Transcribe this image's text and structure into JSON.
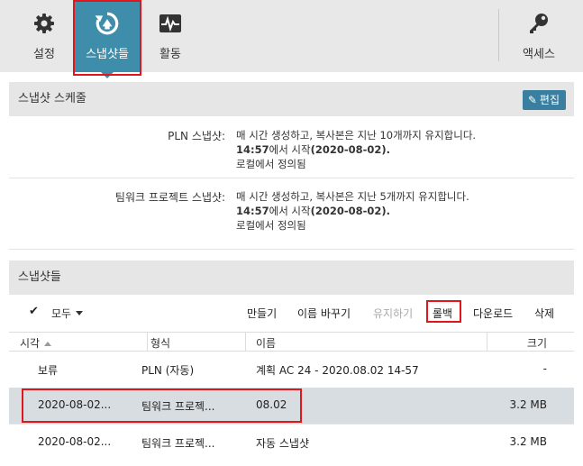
{
  "toolbar": {
    "settings_label": "설정",
    "snapshots_label": "스냅샷들",
    "activity_label": "활동",
    "access_label": "액세스"
  },
  "schedule": {
    "title": "스냅샷 스케줄",
    "edit_label": "편집",
    "rows": [
      {
        "label": "PLN 스냅샷:",
        "line1": "매 시간 생성하고, 복사본은 지난 10개까지 유지합니다.",
        "line2_time": "14:57",
        "line2_mid": "에서 시작",
        "line2_date": "(2020-08-02).",
        "line3": "로컬에서 정의됨"
      },
      {
        "label": "팀워크 프로젝트 스냅샷:",
        "line1": "매 시간 생성하고, 복사본은 지난 5개까지 유지합니다.",
        "line2_time": "14:57",
        "line2_mid": "에서 시작",
        "line2_date": "(2020-08-02).",
        "line3": "로컬에서 정의됨"
      }
    ]
  },
  "snapshots": {
    "title": "스냅샷들",
    "select_all_label": "모두",
    "actions": {
      "create": "만들기",
      "rename": "이름 바꾸기",
      "keep": "유지하기",
      "rollback": "롤백",
      "download": "다운로드",
      "delete": "삭제"
    },
    "columns": {
      "time": "시각",
      "type": "형식",
      "name": "이름",
      "size": "크기"
    },
    "rows": [
      {
        "time": "보류",
        "type": "PLN (자동)",
        "name": "계획 AC 24 - 2020.08.02 14-57",
        "size": "-"
      },
      {
        "time": "2020-08-02...",
        "type": "팀워크 프로젝...",
        "name": "08.02",
        "size": "3.2 MB"
      },
      {
        "time": "2020-08-02...",
        "type": "팀워크 프로젝...",
        "name": "자동 스냅샷",
        "size": "3.2 MB"
      }
    ]
  },
  "colors": {
    "accent": "#3e8eab",
    "highlight": "#e0161c",
    "selected_row": "#d7dde1"
  }
}
